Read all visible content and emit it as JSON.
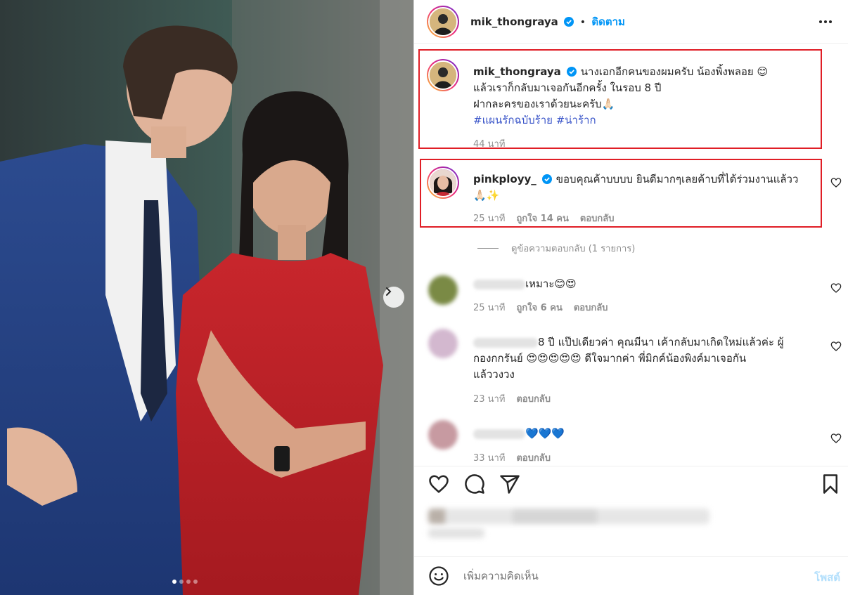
{
  "post": {
    "author": "mik_thongraya",
    "follow_label": "ติดตาม",
    "carousel": {
      "slide_count": 4,
      "active_index": 0
    }
  },
  "caption": {
    "username": "mik_thongraya",
    "line1": "นางเอกอีกคนของผมครับ น้องพิ้งพลอย 😊",
    "line2": "แล้วเราก็กลับมาเจอกันอีกครั้ง ในรอบ 8 ปี",
    "line3": "ฝากละครของเราด้วยนะครับ🙏🏻",
    "hashtag1": "#แผนรักฉบับร้าย",
    "hashtag2": "#น่าร้าก",
    "time": "44 นาที"
  },
  "comments": [
    {
      "username": "pinkployy_",
      "line1": "ขอบคุณค้าบบบบ ยินดีมากๆเลยค้าบที่ได้ร่วมงานแล้วว",
      "line2": "🙏🏻✨",
      "time": "25 นาที",
      "likes": "ถูกใจ 14 คน",
      "reply": "ตอบกลับ"
    },
    {
      "text": "เหมาะ😊😍",
      "time": "25 นาที",
      "likes": "ถูกใจ 6 คน",
      "reply": "ตอบกลับ"
    },
    {
      "line1": "8 ปี แป๊ปเดียวค่า คุณมีนา เค้ากลับมาเกิดใหม่แล้วค่ะ ผู้",
      "line2": "กองกกรันย์ 😍😍😍😍😍  ดีใจมากค่า พี่มิกค์น้องพิงค์มาเจอกัน",
      "line3": "แล้ววงวง",
      "time": "23 นาที",
      "reply": "ตอบกลับ"
    },
    {
      "text": "💙💙💙",
      "time": "33 นาที",
      "reply": "ตอบกลับ"
    }
  ],
  "view_replies": "ดูข้อความตอบกลับ (1 รายการ)",
  "composer": {
    "placeholder": "เพิ่มความคิดเห็น",
    "post_label": "โพสต์"
  },
  "colors": {
    "accent": "#0095f6",
    "highlight_box": "#e01e26",
    "hashtag": "#3a55c9",
    "muted": "#8e8e8e"
  }
}
